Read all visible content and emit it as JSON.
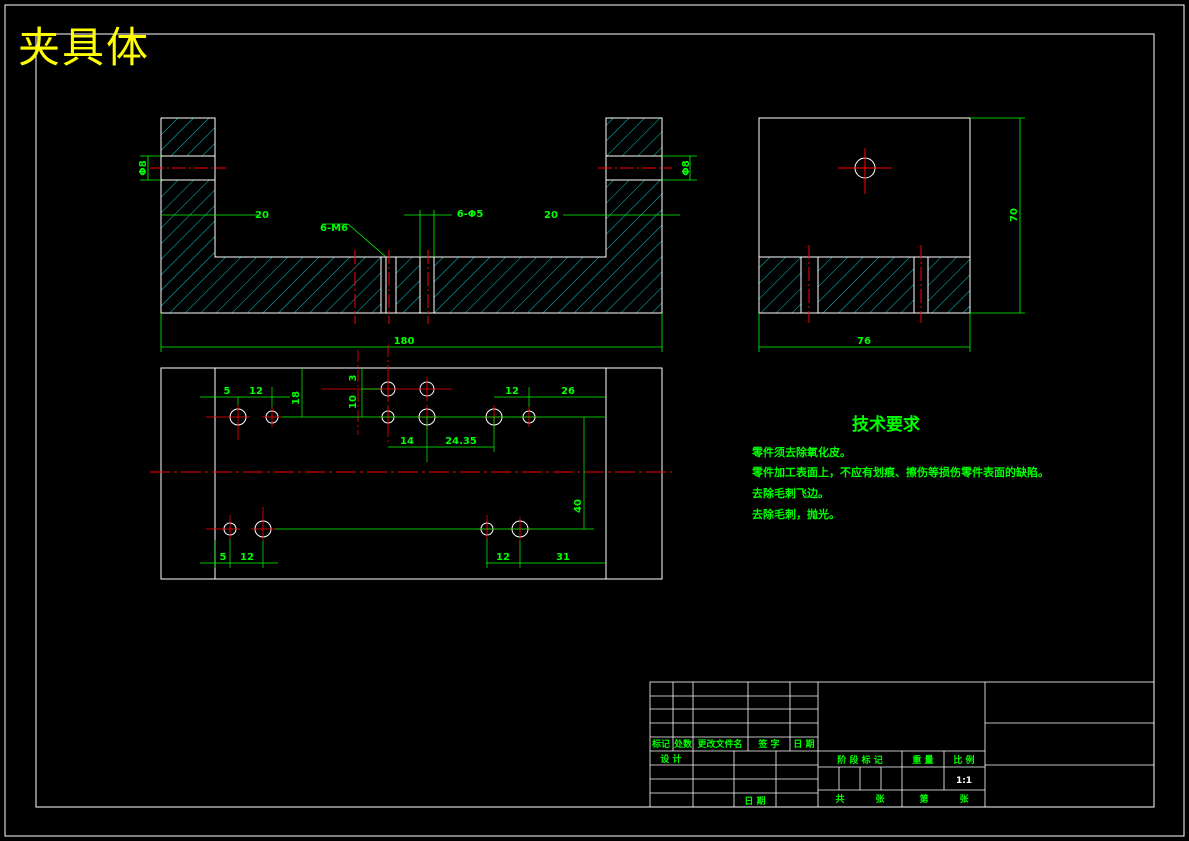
{
  "title": "夹具体",
  "colors": {
    "background": "#000000",
    "outline": "#ffffff",
    "dimension": "#00ff00",
    "hatch": "#00ffff",
    "centerline": "#ff0000",
    "title": "#ffff00"
  },
  "front_view": {
    "dim_overall_length": "180",
    "dim_left_slot": "20",
    "dim_right_slot": "20",
    "dim_left_hole": "Φ8",
    "dim_right_hole": "Φ8",
    "label_thread": "6-M6",
    "label_holes": "6-Φ5"
  },
  "side_view": {
    "dim_width": "76",
    "dim_height": "70"
  },
  "top_view": {
    "dims": [
      "5",
      "12",
      "18",
      "3",
      "10",
      "12",
      "26",
      "14",
      "24.35",
      "40",
      "5",
      "12",
      "12",
      "31"
    ]
  },
  "technical_requirements": {
    "heading": "技术要求",
    "items": [
      "零件须去除氧化皮。",
      "零件加工表面上，不应有划痕、擦伤等损伤零件表面的缺陷。",
      "去除毛刺飞边。",
      "去除毛刺，抛光。"
    ]
  },
  "title_block": {
    "rev_headers": [
      "标记",
      "处数",
      "更改文件名",
      "签 字",
      "日 期"
    ],
    "design_label": "设 计",
    "date_label": "日 期",
    "stage_label": "阶 段 标 记",
    "weight_label": "重 量",
    "scale_label": "比 例",
    "scale_value": "1:1",
    "sheets_total_label": "共",
    "sheets_label": "张",
    "sheet_no_label": "第",
    "sheet_label": "张"
  }
}
